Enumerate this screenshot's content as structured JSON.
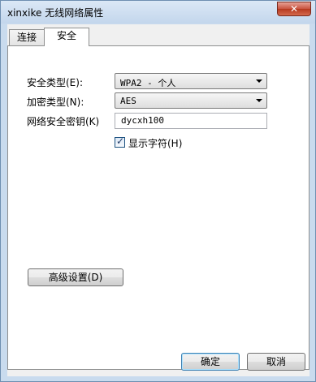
{
  "window": {
    "title": "xinxike 无线网络属性",
    "close_glyph": "✕"
  },
  "tabs": [
    {
      "label": "连接",
      "selected": false
    },
    {
      "label": "安全",
      "selected": true
    }
  ],
  "security": {
    "security_type_label": "安全类型(E):",
    "security_type_value": "WPA2 - 个人",
    "encryption_type_label": "加密类型(N):",
    "encryption_type_value": "AES",
    "network_key_label": "网络安全密钥(K)",
    "network_key_value": "dycxh100",
    "show_characters_label": "显示字符(H)",
    "show_characters_checked": true,
    "check_glyph": "✓"
  },
  "buttons": {
    "advanced_label": "高级设置(D)",
    "ok_label": "确定",
    "cancel_label": "取消"
  },
  "icons": {
    "close": "close-icon",
    "dropdown": "chevron-down-icon",
    "check": "check-icon"
  }
}
